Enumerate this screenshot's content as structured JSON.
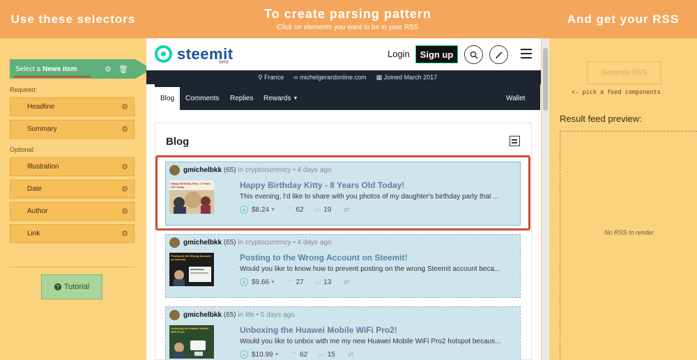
{
  "header": {
    "left_title": "Use these selectors",
    "mid_title": "To create parsing pattern",
    "mid_subtitle": "Click on elements you want to be in your RSS",
    "right_title": "And get your RSS"
  },
  "selectors": {
    "news_item": {
      "prefix": "Select a",
      "label": "News item"
    },
    "required_label": "Required:",
    "required": [
      {
        "label": "Headline"
      },
      {
        "label": "Summary"
      }
    ],
    "optional_label": "Optional:",
    "optional": [
      {
        "label": "Illustration"
      },
      {
        "label": "Date"
      },
      {
        "label": "Author"
      },
      {
        "label": "Link"
      }
    ],
    "tutorial_label": "Tutorial"
  },
  "steemit": {
    "logo_text": "steemit",
    "logo_badge": "beta",
    "login_label": "Login",
    "signup_label": "Sign up",
    "profile": {
      "location": "France",
      "website": "michelgerardonline.com",
      "joined": "Joined March 2017"
    },
    "tabs": [
      {
        "label": "Blog"
      },
      {
        "label": "Comments"
      },
      {
        "label": "Replies"
      },
      {
        "label": "Rewards"
      }
    ],
    "wallet_label": "Wallet",
    "blog_heading": "Blog",
    "posts": [
      {
        "author": "gmichelbkk",
        "rep": "(65)",
        "category": "in cryptocurrency",
        "age": "• 4 days ago",
        "title": "Happy Birthday Kitty - 8 Years Old Today!",
        "body": "This evening, I'd like to share with you photos of my daughter's birthday party that ...",
        "thumb_caption": "Happy Birthday Kitty - 8 Years Old Today",
        "payout": "$8.24",
        "votes": "62",
        "comments": "19"
      },
      {
        "author": "gmichelbkk",
        "rep": "(65)",
        "category": "in cryptocurrency",
        "age": "• 4 days ago",
        "title": "Posting to the Wrong Account on Steemit!",
        "body": "Would you like to know how to prevent posting on the wrong Steemit account beca...",
        "thumb_caption": "Posting to the Wrong Account on Steemit!",
        "payout": "$9.66",
        "votes": "27",
        "comments": "13"
      },
      {
        "author": "gmichelbkk",
        "rep": "(65)",
        "category": "in life",
        "age": "• 5 days ago",
        "title": "Unboxing the Huawei Mobile WiFi Pro2!",
        "body": "Would you like to unbox with me my new Huawei Mobile WiFi Pro2 hotspot becaus...",
        "thumb_caption": "Unboxing the Huawei Mobile WiFi Pro2!",
        "payout": "$10.99",
        "votes": "62",
        "comments": "15"
      }
    ]
  },
  "rss": {
    "generate_label": "Generate RSS",
    "hint": "<- pick a feed components",
    "preview_label": "Result feed preview:",
    "empty_text": "No RSS to render"
  },
  "colors": {
    "accent_orange": "#f4a65b",
    "panel_yellow": "#fbd27e",
    "select_green": "#5fb07a",
    "steemit_teal": "#07d6aa",
    "selection_red": "#d24a3a",
    "highlight_blue": "#cfe5ee"
  }
}
